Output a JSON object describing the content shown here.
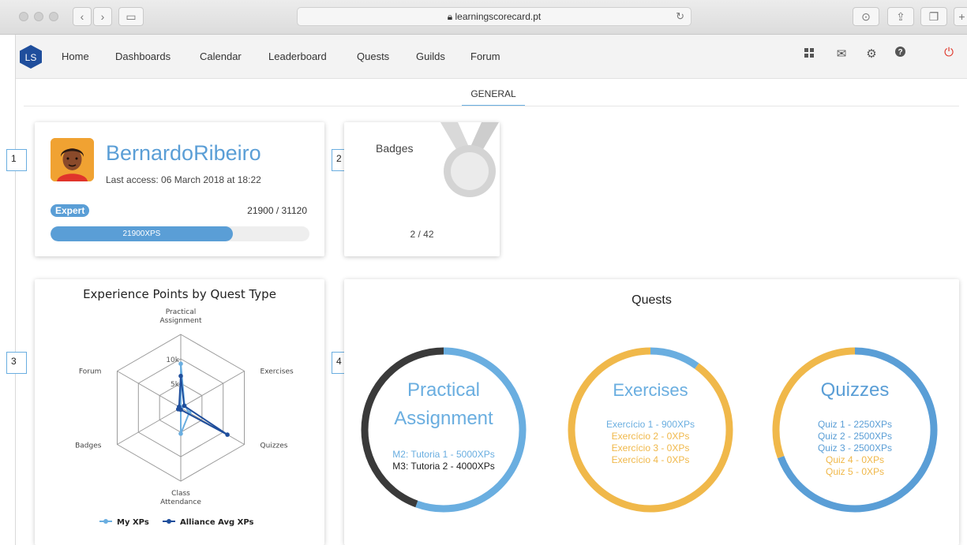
{
  "browser": {
    "url": "learningscorecard.pt",
    "lock_icon": "lock-icon",
    "reload_icon": "reload-icon"
  },
  "nav": {
    "logo": "LS",
    "items": [
      "Home",
      "Dashboards",
      "Calendar",
      "Leaderboard",
      "Quests",
      "Guilds",
      "Forum"
    ],
    "icons": [
      "grid-icon",
      "mail-icon",
      "gear-icon",
      "help-icon",
      "power-icon"
    ]
  },
  "tabs": {
    "active": "GENERAL"
  },
  "markers": [
    "1",
    "2",
    "3",
    "4"
  ],
  "profile": {
    "name": "BernardoRibeiro",
    "last_access": "Last access: 06 March 2018 at 18:22",
    "level": "Expert",
    "xp_fraction": "21900 / 31120",
    "progress_label": "21900XPS",
    "progress_value": 0.704
  },
  "badges": {
    "title": "Badges",
    "count": "2 / 42"
  },
  "colors": {
    "accent": "#5a9ed6",
    "light_blue": "#6aaee0",
    "dark_blue": "#1f4e9c",
    "orange": "#f0b84a",
    "dark": "#3a3a3a",
    "power_red": "#e03a2e"
  },
  "chart_data": {
    "type": "radar",
    "title": "Experience Points by Quest Type",
    "axes": [
      "Practical Assignment",
      "Exercises",
      "Quizzes",
      "Class Attendance",
      "Badges",
      "Forum"
    ],
    "axis_lines": [
      [
        "Practical",
        "Assignment"
      ],
      [
        "Exercises"
      ],
      [
        "Quizzes"
      ],
      [
        "Class",
        "Attendance"
      ],
      [
        "Badges"
      ],
      [
        "Forum"
      ]
    ],
    "tick_labels": [
      "5k",
      "10k"
    ],
    "rmax": 15000,
    "series": [
      {
        "name": "My XPs",
        "color": "#6aaee0",
        "values": [
          9000,
          900,
          2000,
          5300,
          0,
          0
        ]
      },
      {
        "name": "Alliance Avg XPs",
        "color": "#1f4e9c",
        "values": [
          6500,
          800,
          11000,
          400,
          600,
          400
        ]
      }
    ],
    "legend": "bottom"
  },
  "quests": {
    "title": "Quests",
    "cards": [
      {
        "title_lines": [
          "Practical",
          "Assignment"
        ],
        "title_color": "#6aaee0",
        "segments": [
          {
            "value": 5000,
            "color": "#6aaee0"
          },
          {
            "value": 4000,
            "color": "#3a3a3a"
          }
        ],
        "items": [
          {
            "text": "M2: Tutoria 1 - 5000XPs",
            "color": "#6aaee0"
          },
          {
            "text": "M3: Tutoria 2 - 4000XPs",
            "color": "#222222"
          }
        ]
      },
      {
        "title_lines": [
          "Exercises"
        ],
        "title_color": "#6aaee0",
        "segments": [
          {
            "value": 900,
            "color": "#6aaee0"
          },
          {
            "value": 8100,
            "color": "#f0b84a"
          }
        ],
        "items": [
          {
            "text": "Exercício 1 - 900XPs",
            "color": "#6aaee0"
          },
          {
            "text": "Exercício 2 - 0XPs",
            "color": "#f0b84a"
          },
          {
            "text": "Exercício 3 - 0XPs",
            "color": "#f0b84a"
          },
          {
            "text": "Exercício 4 - 0XPs",
            "color": "#f0b84a"
          }
        ]
      },
      {
        "title_lines": [
          "Quizzes"
        ],
        "title_color": "#5a9ed6",
        "segments": [
          {
            "value": 7250,
            "color": "#5a9ed6"
          },
          {
            "value": 3200,
            "color": "#f0b84a"
          }
        ],
        "items": [
          {
            "text": "Quiz 1 - 2250XPs",
            "color": "#5a9ed6"
          },
          {
            "text": "Quiz 2 - 2500XPs",
            "color": "#5a9ed6"
          },
          {
            "text": "Quiz 3 - 2500XPs",
            "color": "#5a9ed6"
          },
          {
            "text": "Quiz 4 - 0XPs",
            "color": "#f0b84a"
          },
          {
            "text": "Quiz 5 - 0XPs",
            "color": "#f0b84a"
          }
        ]
      }
    ]
  }
}
